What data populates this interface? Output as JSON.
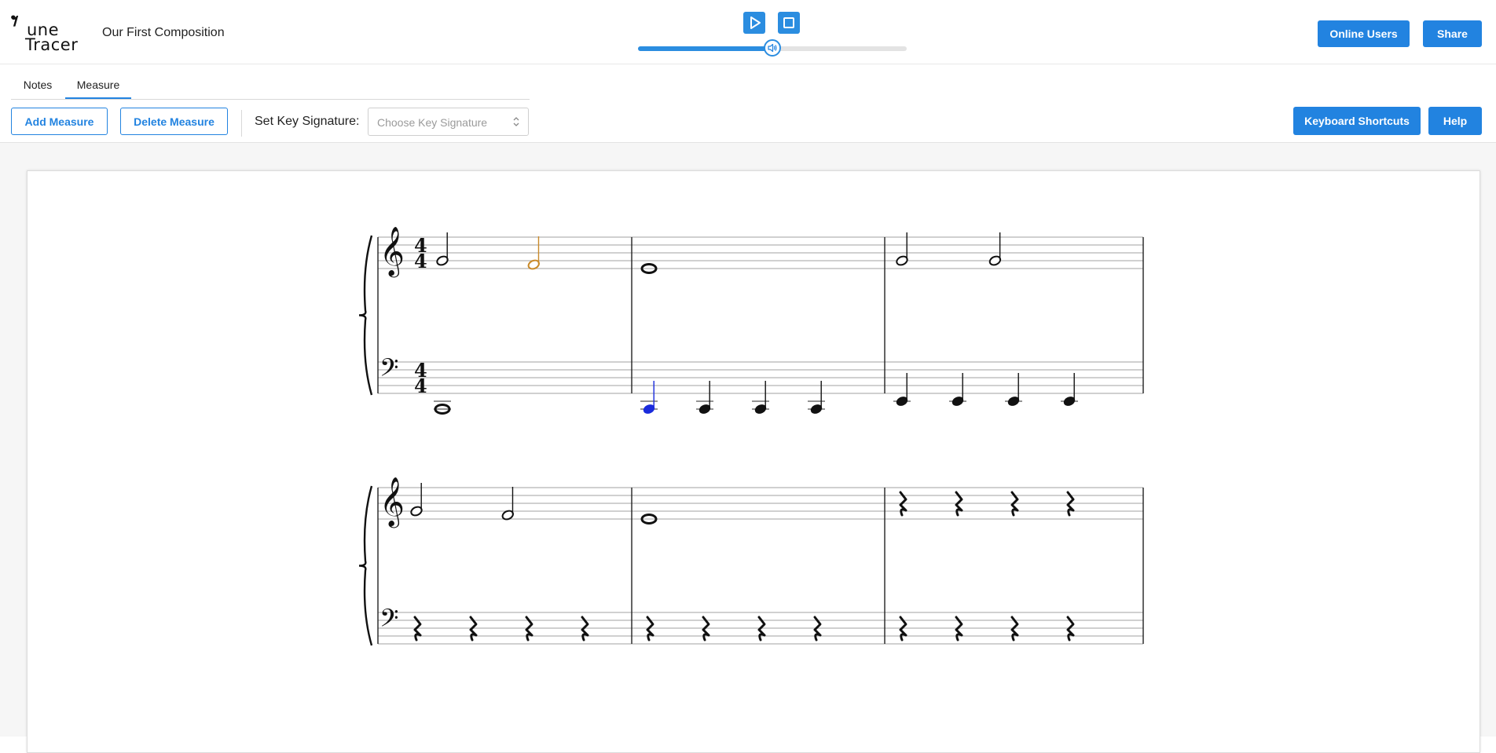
{
  "header": {
    "logo_text_line1": "une",
    "logo_text_line2": "Tracer",
    "logo_mark": "𝄾",
    "title": "Our First Composition",
    "play_icon": "play-icon",
    "stop_icon": "stop-icon",
    "volume_level": 0.5,
    "online_users_label": "Online Users",
    "share_label": "Share"
  },
  "toolbar": {
    "tabs": [
      {
        "label": "Notes",
        "active": false
      },
      {
        "label": "Measure",
        "active": true
      }
    ],
    "add_measure_label": "Add Measure",
    "delete_measure_label": "Delete Measure",
    "key_signature_label": "Set Key Signature:",
    "key_signature_placeholder": "Choose Key Signature",
    "keyboard_shortcuts_label": "Keyboard Shortcuts",
    "help_label": "Help"
  },
  "colors": {
    "accent": "#2283e0",
    "highlight_orange": "#c98a2a",
    "highlight_blue": "#1a2bdc"
  },
  "score": {
    "time_signature": {
      "top": "4",
      "bottom": "4"
    },
    "systems": [
      {
        "measures": [
          {
            "treble": [
              {
                "dur": "half",
                "pitch": "G4"
              },
              {
                "dur": "half",
                "pitch": "F4",
                "color": "orange"
              }
            ],
            "bass": [
              {
                "dur": "whole",
                "pitch": "C2"
              }
            ]
          },
          {
            "treble": [
              {
                "dur": "whole",
                "pitch": "E4"
              }
            ],
            "bass": [
              {
                "dur": "quarter",
                "pitch": "C2",
                "color": "blue"
              },
              {
                "dur": "quarter",
                "pitch": "C2"
              },
              {
                "dur": "quarter",
                "pitch": "C2"
              },
              {
                "dur": "quarter",
                "pitch": "C2"
              }
            ]
          },
          {
            "treble": [
              {
                "dur": "half",
                "pitch": "G4"
              },
              {
                "dur": "half",
                "pitch": "G4"
              }
            ],
            "bass": [
              {
                "dur": "quarter",
                "pitch": "E2"
              },
              {
                "dur": "quarter",
                "pitch": "E2"
              },
              {
                "dur": "quarter",
                "pitch": "E2"
              },
              {
                "dur": "quarter",
                "pitch": "E2"
              }
            ]
          }
        ]
      },
      {
        "measures": [
          {
            "treble": [
              {
                "dur": "half",
                "pitch": "G4"
              },
              {
                "dur": "half",
                "pitch": "F4"
              }
            ],
            "bass": [
              {
                "dur": "quarter-rest"
              },
              {
                "dur": "quarter-rest"
              },
              {
                "dur": "quarter-rest"
              },
              {
                "dur": "quarter-rest"
              }
            ]
          },
          {
            "treble": [
              {
                "dur": "whole",
                "pitch": "E4"
              }
            ],
            "bass": [
              {
                "dur": "quarter-rest"
              },
              {
                "dur": "quarter-rest"
              },
              {
                "dur": "quarter-rest"
              },
              {
                "dur": "quarter-rest"
              }
            ]
          },
          {
            "treble": [
              {
                "dur": "quarter-rest"
              },
              {
                "dur": "quarter-rest"
              },
              {
                "dur": "quarter-rest"
              },
              {
                "dur": "quarter-rest"
              }
            ],
            "bass": [
              {
                "dur": "quarter-rest"
              },
              {
                "dur": "quarter-rest"
              },
              {
                "dur": "quarter-rest"
              },
              {
                "dur": "quarter-rest"
              }
            ]
          }
        ]
      }
    ]
  }
}
